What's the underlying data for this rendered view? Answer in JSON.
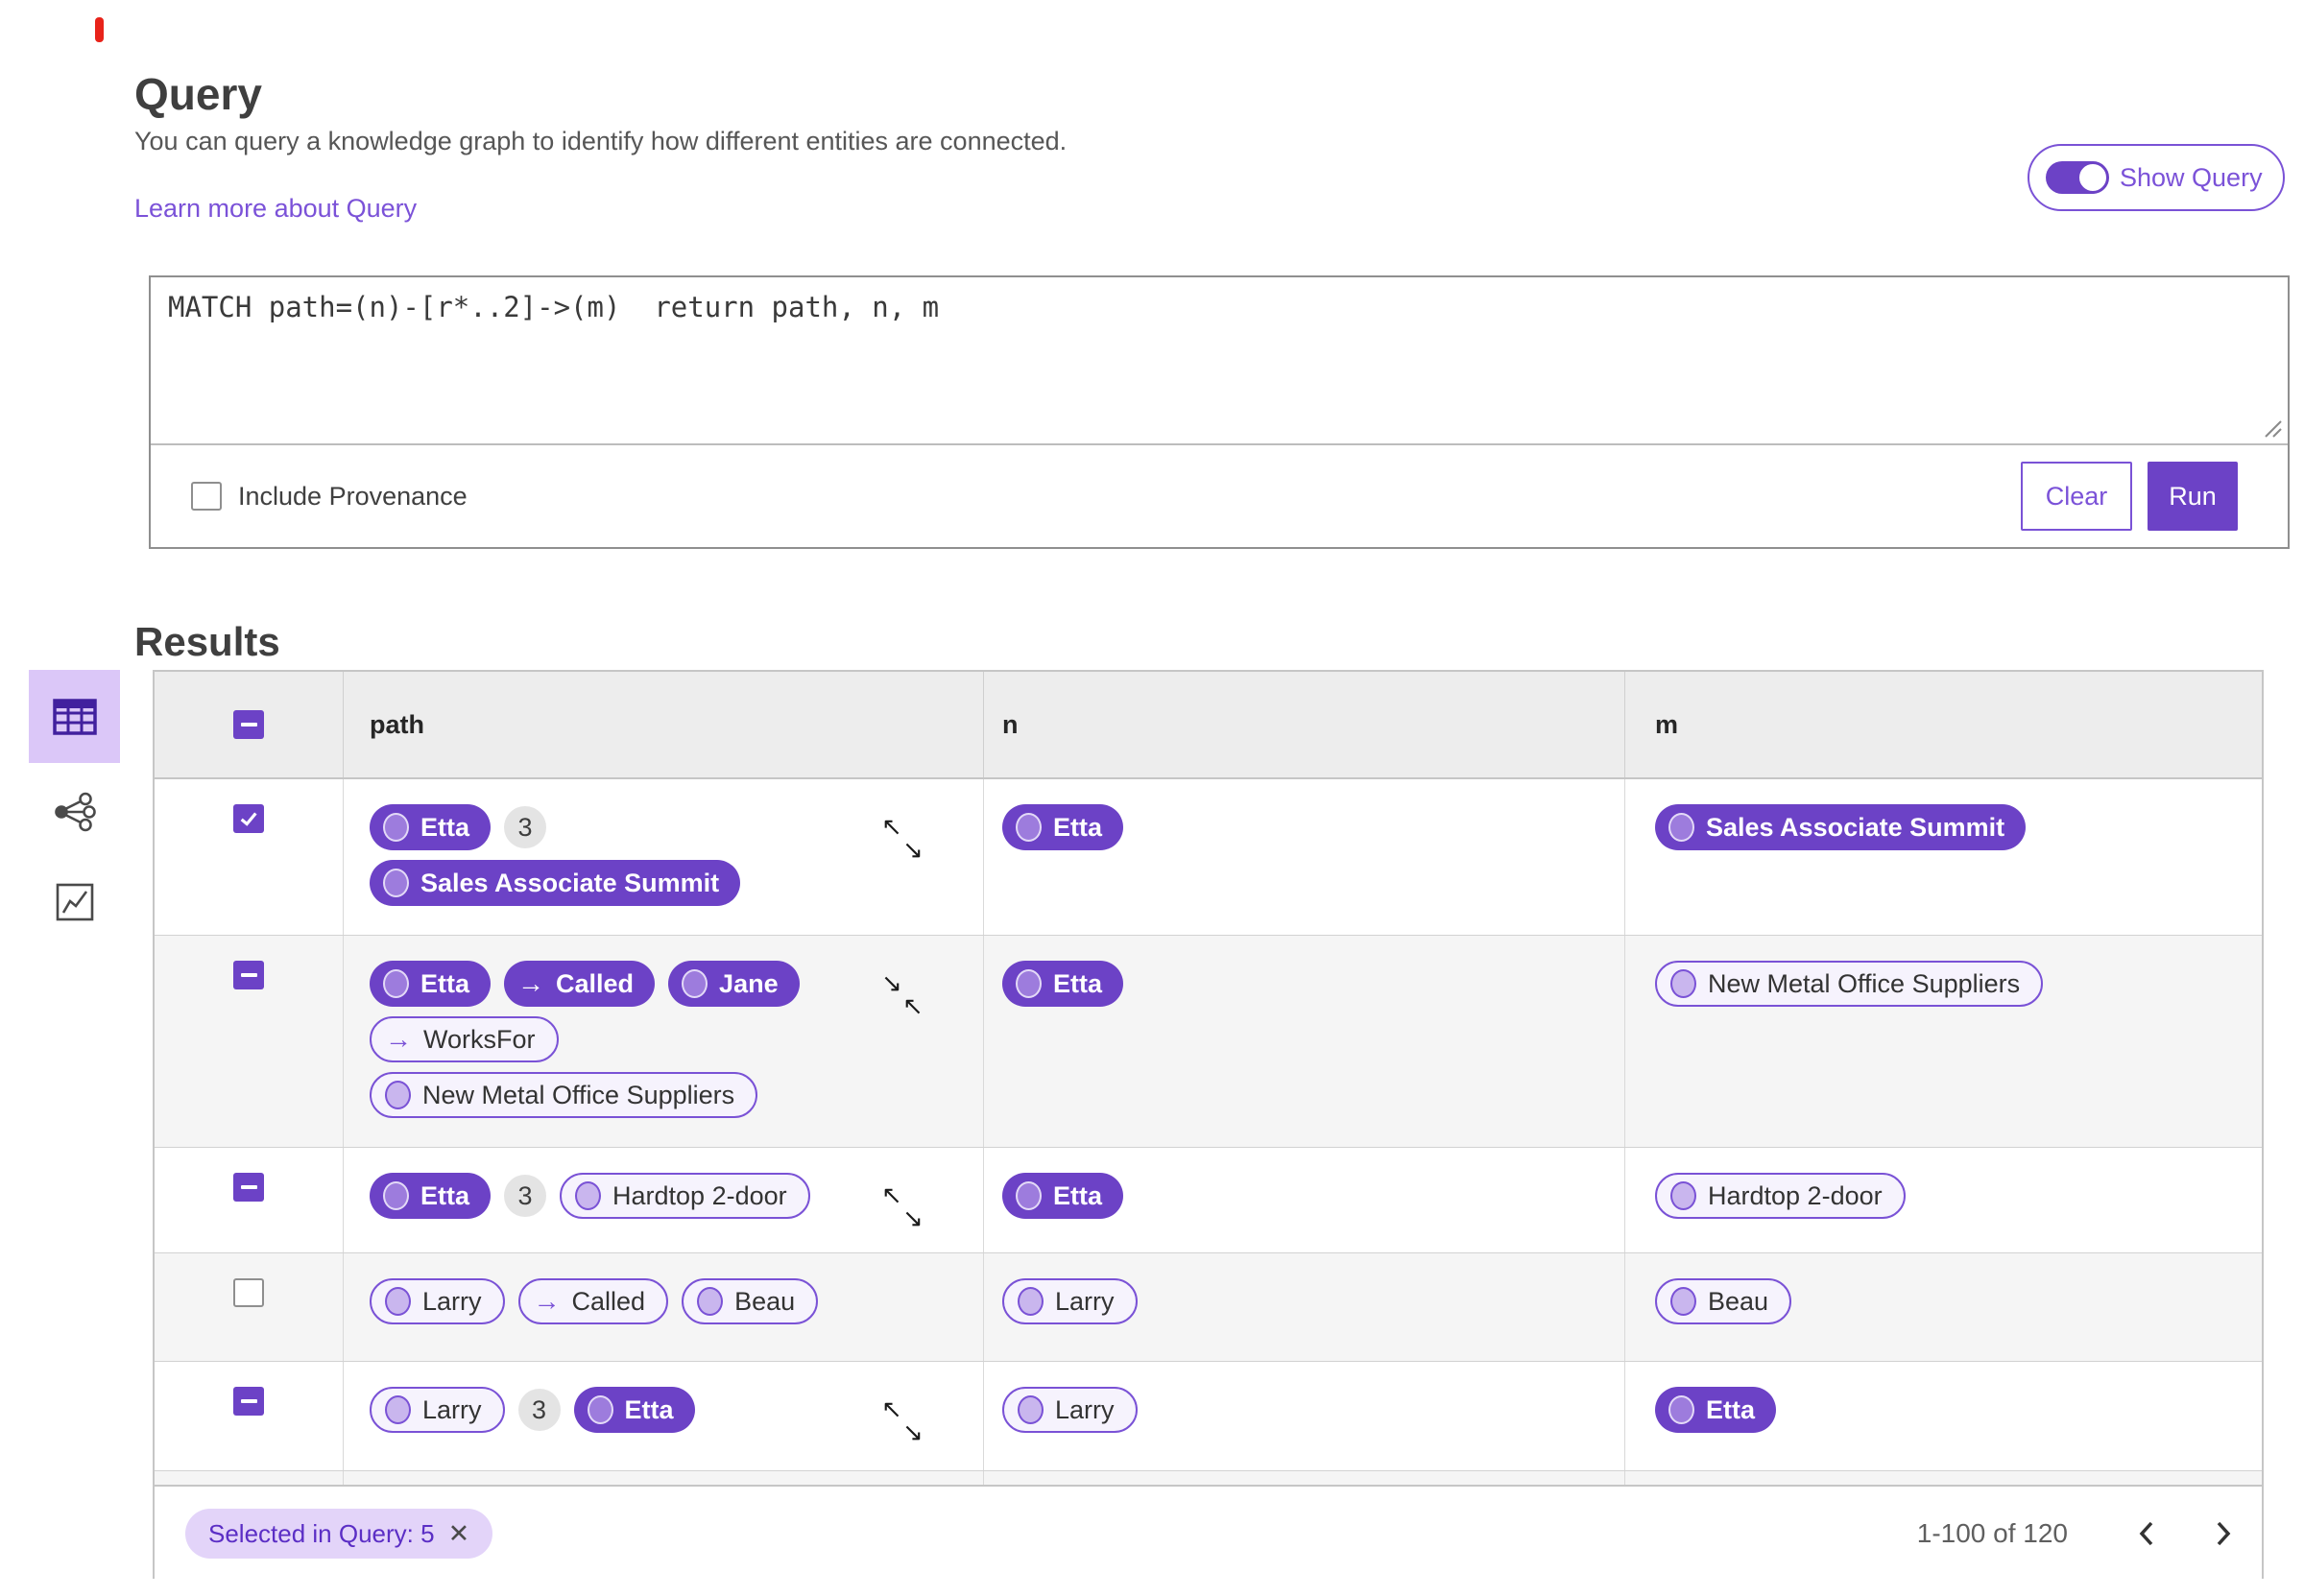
{
  "page": {
    "title": "Query",
    "description": "You can query a knowledge graph to identify how different entities are connected.",
    "learn_more_link": "Learn more about Query",
    "show_query_label": "Show Query",
    "show_query_on": true
  },
  "query_editor": {
    "query_text": "MATCH path=(n)-[r*..2]->(m)  return path, n, m",
    "include_provenance_label": "Include Provenance",
    "include_provenance_checked": false,
    "clear_label": "Clear",
    "run_label": "Run"
  },
  "results": {
    "title": "Results",
    "view_switcher": [
      {
        "icon": "table-view-icon",
        "selected": true
      },
      {
        "icon": "graph-view-icon",
        "selected": false
      },
      {
        "icon": "chart-view-icon",
        "selected": false
      }
    ],
    "columns": [
      "path",
      "n",
      "m"
    ],
    "header_checkbox": "indeterminate",
    "rows": [
      {
        "checkbox": "checked",
        "expander": "expand",
        "path": [
          [
            {
              "kind": "node",
              "variant": "filled",
              "label": "Etta"
            },
            {
              "kind": "badge",
              "label": "3"
            }
          ],
          [
            {
              "kind": "node",
              "variant": "filled",
              "label": "Sales Associate Summit"
            }
          ]
        ],
        "n": {
          "kind": "node",
          "variant": "filled",
          "label": "Etta"
        },
        "m": {
          "kind": "node",
          "variant": "filled",
          "label": "Sales Associate Summit"
        }
      },
      {
        "checkbox": "indeterminate",
        "expander": "collapse",
        "path": [
          [
            {
              "kind": "node",
              "variant": "filled",
              "label": "Etta"
            },
            {
              "kind": "edge",
              "variant": "filled",
              "label": "Called"
            },
            {
              "kind": "node",
              "variant": "filled",
              "label": "Jane"
            }
          ],
          [
            {
              "kind": "edge",
              "variant": "outline",
              "label": "WorksFor"
            }
          ],
          [
            {
              "kind": "node",
              "variant": "outline",
              "label": "New Metal Office Suppliers"
            }
          ]
        ],
        "n": {
          "kind": "node",
          "variant": "filled",
          "label": "Etta"
        },
        "m": {
          "kind": "node",
          "variant": "outline",
          "label": "New Metal Office Suppliers"
        }
      },
      {
        "checkbox": "indeterminate",
        "expander": "expand",
        "path": [
          [
            {
              "kind": "node",
              "variant": "filled",
              "label": "Etta"
            },
            {
              "kind": "badge",
              "label": "3"
            },
            {
              "kind": "node",
              "variant": "outline",
              "label": "Hardtop 2-door"
            }
          ]
        ],
        "n": {
          "kind": "node",
          "variant": "filled",
          "label": "Etta"
        },
        "m": {
          "kind": "node",
          "variant": "outline",
          "label": "Hardtop 2-door"
        }
      },
      {
        "checkbox": "unchecked",
        "expander": "none",
        "path": [
          [
            {
              "kind": "node",
              "variant": "outline",
              "label": "Larry"
            },
            {
              "kind": "edge",
              "variant": "outline",
              "label": "Called"
            },
            {
              "kind": "node",
              "variant": "outline",
              "label": "Beau"
            }
          ]
        ],
        "n": {
          "kind": "node",
          "variant": "outline",
          "label": "Larry"
        },
        "m": {
          "kind": "node",
          "variant": "outline",
          "label": "Beau"
        }
      },
      {
        "checkbox": "indeterminate",
        "expander": "expand",
        "path": [
          [
            {
              "kind": "node",
              "variant": "outline",
              "label": "Larry"
            },
            {
              "kind": "badge",
              "label": "3"
            },
            {
              "kind": "node",
              "variant": "filled",
              "label": "Etta"
            }
          ]
        ],
        "n": {
          "kind": "node",
          "variant": "outline",
          "label": "Larry"
        },
        "m": {
          "kind": "node",
          "variant": "filled",
          "label": "Etta"
        }
      },
      {
        "partial": true,
        "checkbox": "none",
        "expander": "none",
        "path": [
          [
            {
              "kind": "node",
              "variant": "outline",
              "label": ""
            },
            {
              "kind": "badge",
              "label": ""
            },
            {
              "kind": "node",
              "variant": "outline",
              "label": ""
            }
          ]
        ],
        "n": {
          "kind": "node",
          "variant": "outline",
          "label": ""
        },
        "m": {
          "kind": "node",
          "variant": "outline",
          "label": ""
        }
      }
    ],
    "footer": {
      "filter_chip": "Selected in Query: 5",
      "page_range": "1-100 of 120"
    }
  },
  "colors": {
    "primary_purple": "#6c42c6",
    "outline_purple": "#7a52d6",
    "link_purple": "#7b52d8",
    "chip_bg": "#e3d4f9",
    "selected_view_bg": "#dbc7f8",
    "table_header_bg": "#ededed",
    "alt_row_bg": "#f5f5f5"
  }
}
